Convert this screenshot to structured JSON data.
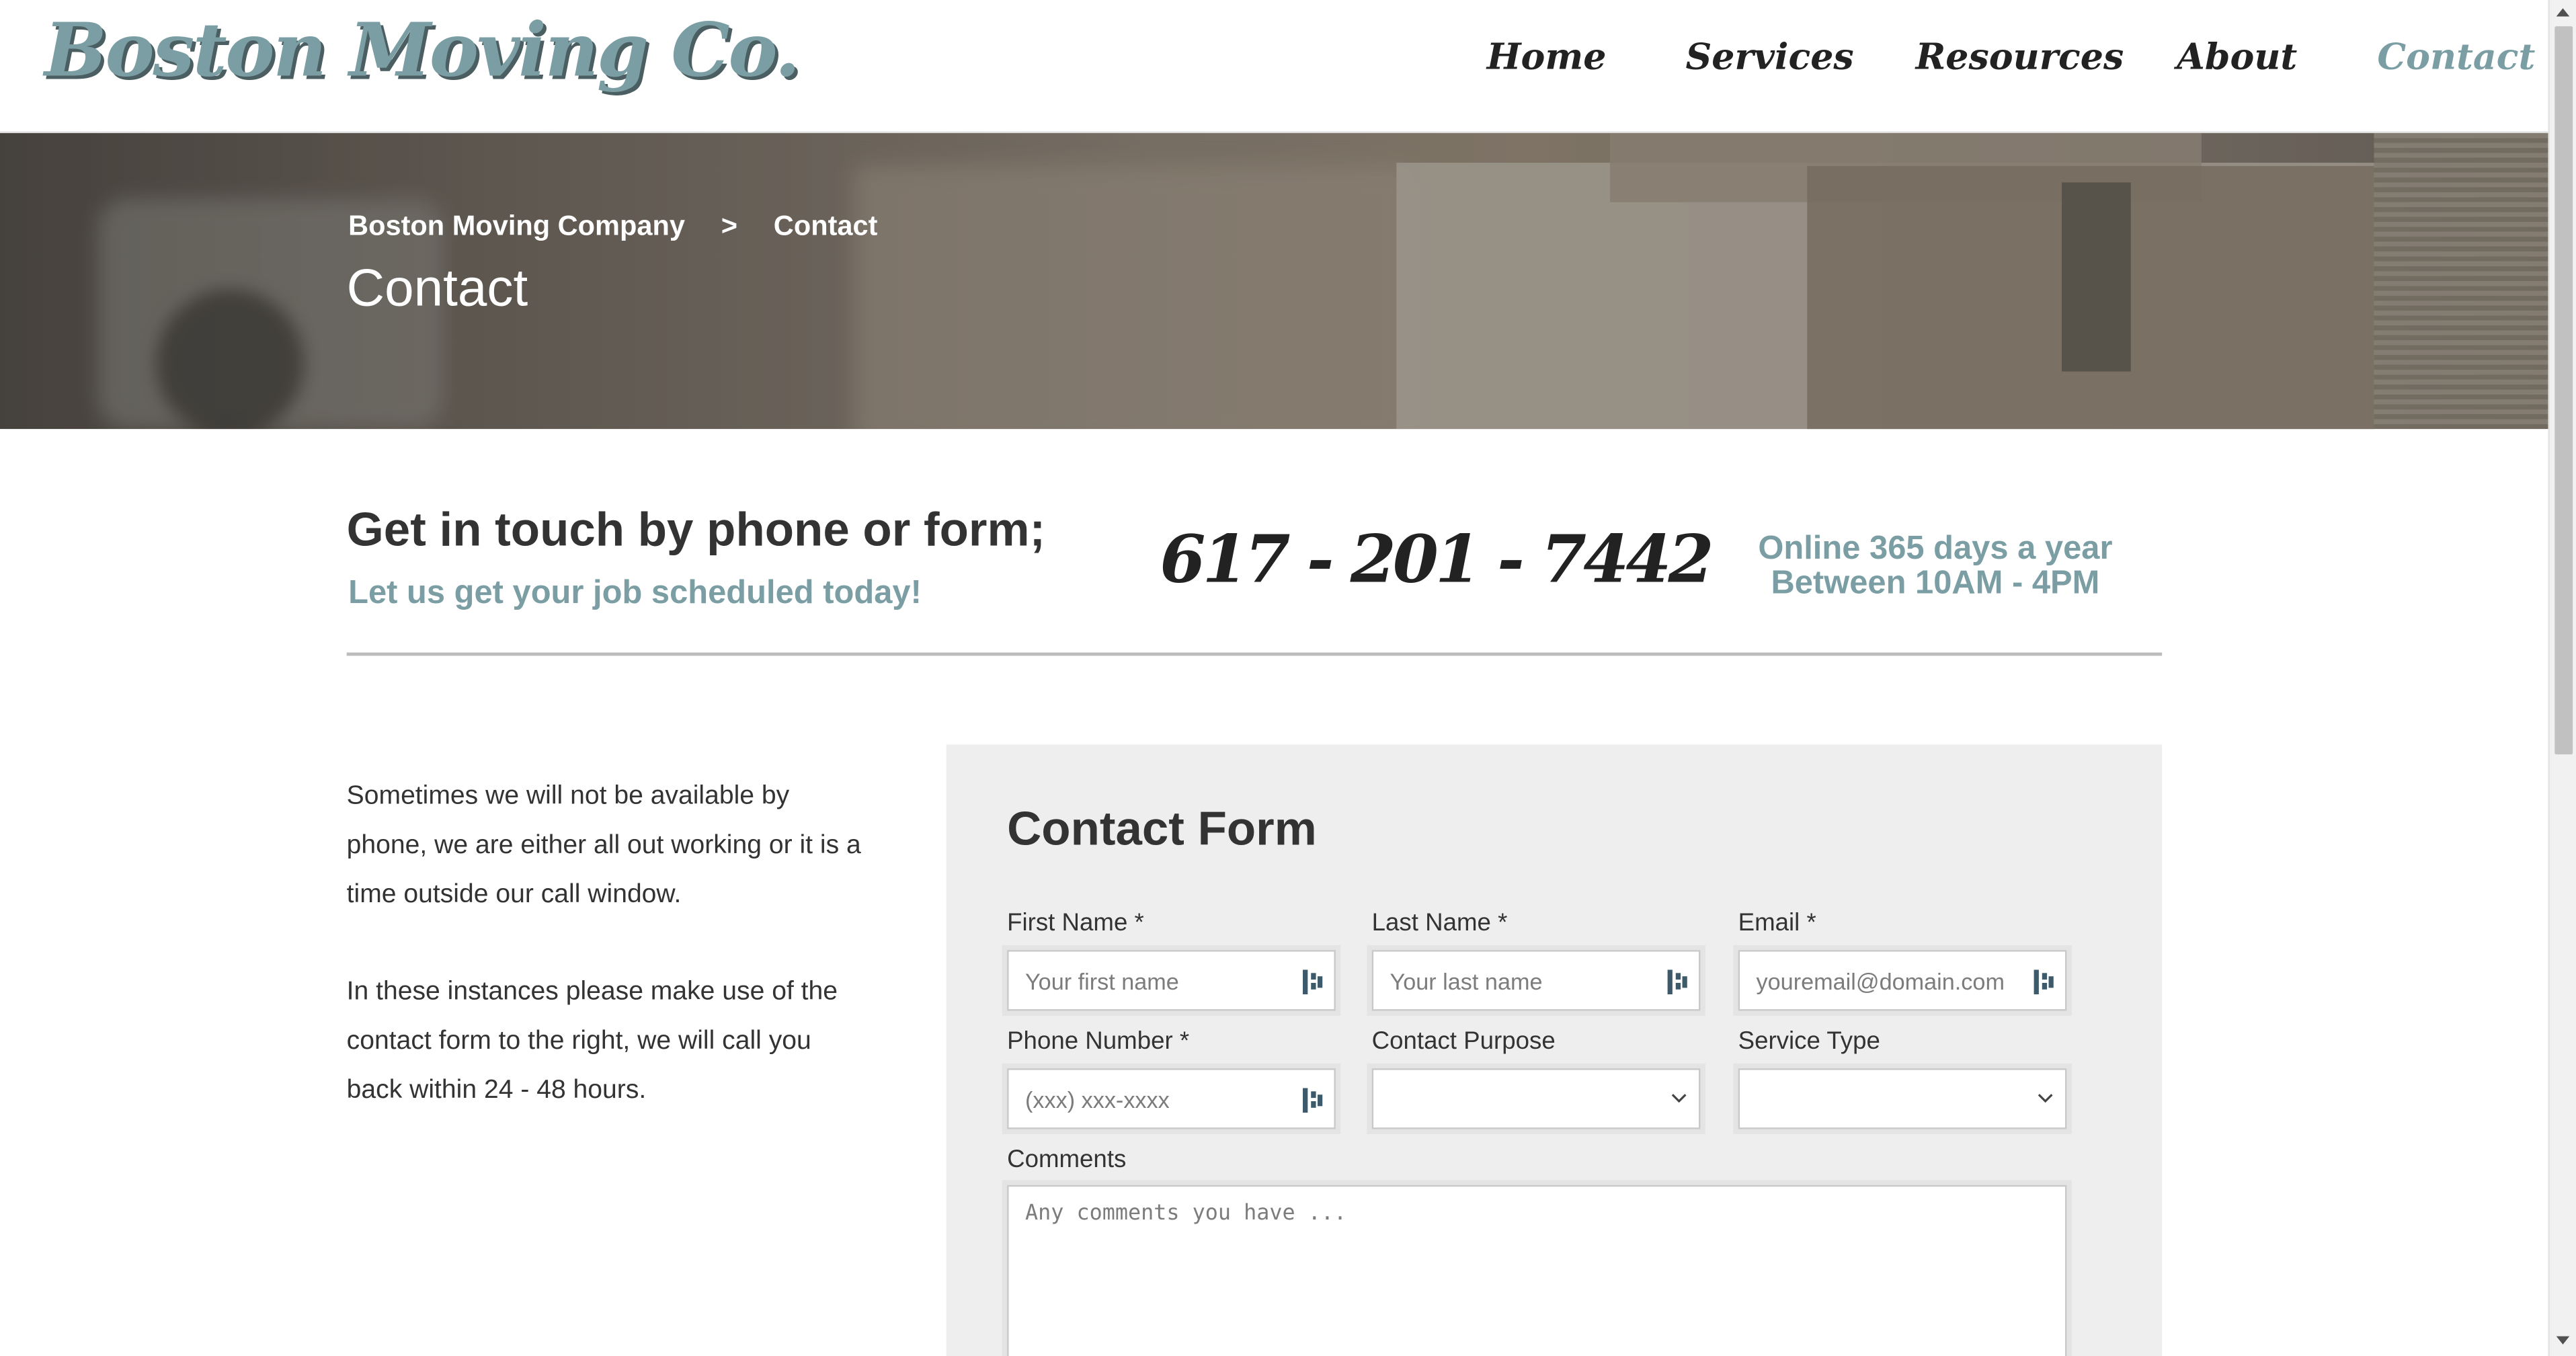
{
  "header": {
    "logo": "Boston Moving Co.",
    "nav": [
      {
        "label": "Home"
      },
      {
        "label": "Services"
      },
      {
        "label": "Resources"
      },
      {
        "label": "About"
      },
      {
        "label": "Contact",
        "active": true
      }
    ]
  },
  "hero": {
    "breadcrumb": {
      "home": "Boston Moving Company",
      "separator": ">",
      "current": "Contact"
    },
    "title": "Contact"
  },
  "intro": {
    "heading": "Get in touch by phone or form;",
    "subheading": "Let us get your job scheduled today!",
    "phone": "617 - 201 - 7442",
    "hours_line1": "Online 365 days a year",
    "hours_line2": "Between 10AM - 4PM"
  },
  "side_text": {
    "paragraph1": "Sometimes we will not be available by phone, we are either all out working or it is a time outside our call window.",
    "paragraph2": "In these instances please make use of the contact form to the right, we will call you back within 24 - 48 hours."
  },
  "form": {
    "title": "Contact Form",
    "first_name": {
      "label": "First Name *",
      "placeholder": "Your first name",
      "value": ""
    },
    "last_name": {
      "label": "Last Name *",
      "placeholder": "Your last name",
      "value": ""
    },
    "email": {
      "label": "Email *",
      "placeholder": "youremail@domain.com",
      "value": ""
    },
    "phone": {
      "label": "Phone Number *",
      "placeholder": "(xxx) xxx-xxxx",
      "value": ""
    },
    "contact_purpose": {
      "label": "Contact Purpose",
      "selected": ""
    },
    "service_type": {
      "label": "Service Type",
      "selected": ""
    },
    "comments": {
      "label": "Comments",
      "placeholder": "Any comments you have ...",
      "value": ""
    }
  },
  "colors": {
    "accent": "#7a9ea3",
    "text": "#333333",
    "form_bg": "#eeeeee"
  },
  "icons": [
    "autofill-icon",
    "chevron-down-icon"
  ]
}
